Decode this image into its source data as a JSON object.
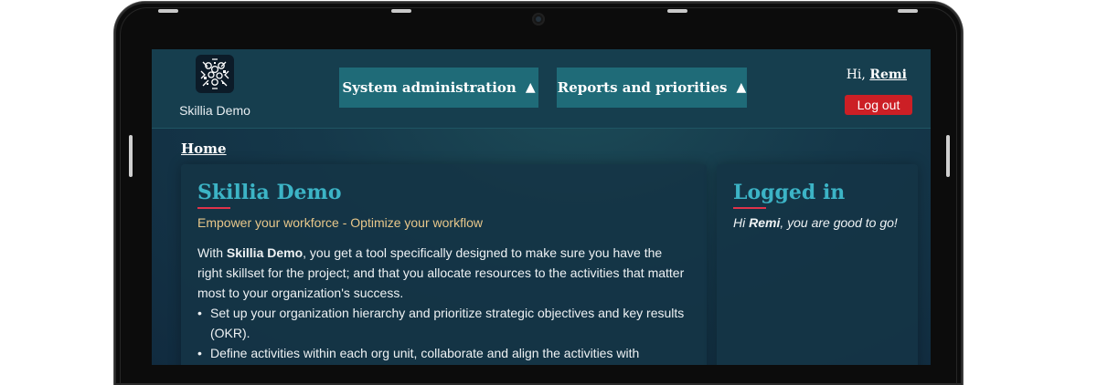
{
  "brand": {
    "name": "Skillia Demo",
    "logo_icon": "skillia-logo-icon"
  },
  "nav": {
    "system_admin": {
      "label": "System administration",
      "arrow": "▲"
    },
    "reports": {
      "label": "Reports and priorities",
      "arrow": "▲"
    }
  },
  "user": {
    "greeting": "Hi, ",
    "name": "Remi",
    "logout_label": "Log out"
  },
  "breadcrumb": {
    "home": "Home"
  },
  "main_card": {
    "title": "Skillia Demo",
    "tagline": "Empower your workforce - Optimize your workflow",
    "intro_prefix": "With ",
    "intro_bold": "Skillia Demo",
    "intro_suffix": ", you get a tool specifically designed to make sure you have the right skillset for the project; and that you allocate resources to the activities that matter most to your organization's success.",
    "bullets": [
      "Set up your organization hierarchy and prioritize strategic objectives and key results (OKR).",
      "Define activities within each org unit, collaborate and align the activities with"
    ]
  },
  "side_card": {
    "title": "Logged in",
    "msg_prefix": "Hi ",
    "msg_name": "Remi",
    "msg_suffix": ", you are good to go!"
  },
  "colors": {
    "accent_teal": "#3cb4c6",
    "nav_button": "#1f6b78",
    "logout_red": "#cc1f25",
    "tagline_gold": "#e8c78a",
    "title_rule": "#e0334a"
  }
}
